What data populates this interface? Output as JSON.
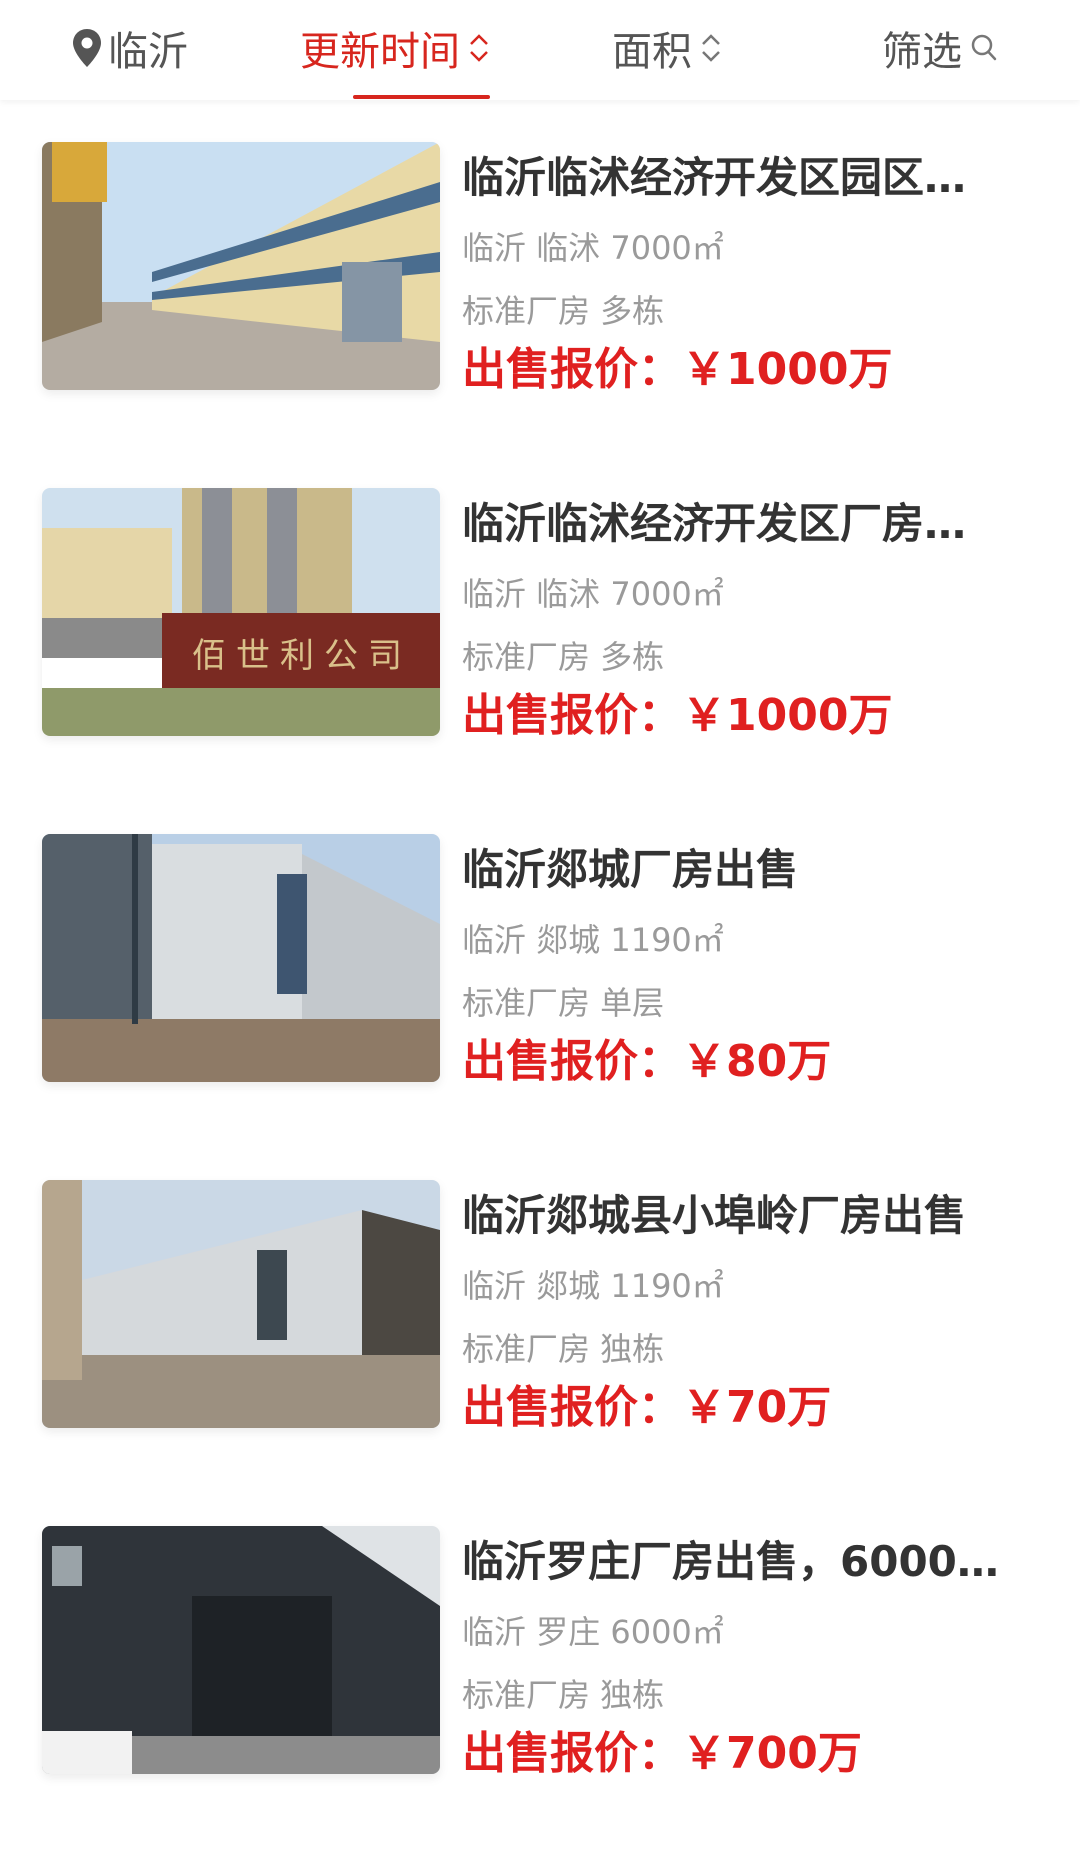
{
  "header": {
    "city": "临沂",
    "tabs": [
      {
        "label": "更新时间",
        "active": true
      },
      {
        "label": "面积",
        "active": false
      },
      {
        "label": "筛选",
        "active": false
      }
    ],
    "accent_color": "#d7261e"
  },
  "listings": [
    {
      "title": "临沂临沭经济开发区园区…",
      "location": "临沂 临沭 7000㎡",
      "type": "标准厂房 多栋",
      "price": "出售报价：￥1000万"
    },
    {
      "title": "临沂临沭经济开发区厂房…",
      "location": "临沂 临沭 7000㎡",
      "type": "标准厂房 多栋",
      "price": "出售报价：￥1000万",
      "sign_text": "佰世利公司"
    },
    {
      "title": "临沂郯城厂房出售",
      "location": "临沂 郯城 1190㎡",
      "type": "标准厂房 单层",
      "price": "出售报价：￥80万"
    },
    {
      "title": "临沂郯城县小埠岭厂房出售",
      "location": "临沂 郯城 1190㎡",
      "type": "标准厂房 独栋",
      "price": "出售报价：￥70万"
    },
    {
      "title": "临沂罗庄厂房出售，6000…",
      "location": "临沂 罗庄 6000㎡",
      "type": "标准厂房 独栋",
      "price": "出售报价：￥700万"
    }
  ]
}
